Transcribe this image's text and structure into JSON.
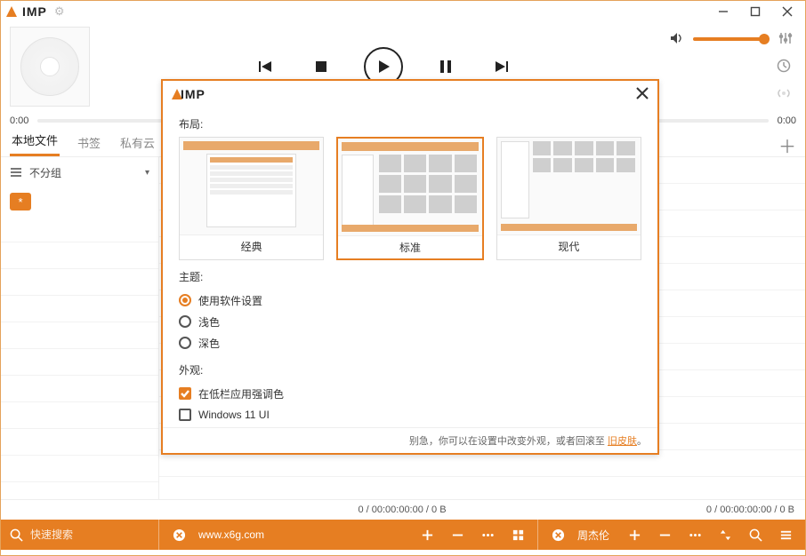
{
  "app": {
    "name": "IMP"
  },
  "window": {
    "minimize": "–",
    "maximize": "▢",
    "close": "×"
  },
  "player": {
    "time_current": "0:00",
    "time_total": "0:00"
  },
  "tabs": {
    "items": [
      {
        "label": "本地文件",
        "active": true
      },
      {
        "label": "书签",
        "active": false
      },
      {
        "label": "私有云",
        "active": false
      }
    ]
  },
  "sidebar": {
    "group_label": "不分组",
    "star": "*"
  },
  "info": {
    "left": "",
    "center": "0 / 00:00:00:00 / 0 B",
    "right": "0 / 00:00:00:00 / 0 B"
  },
  "bottombar": {
    "search_placeholder": "快速搜索",
    "panel1_label": "www.x6g.com",
    "panel2_label": "周杰伦"
  },
  "modal": {
    "layout_title": "布局:",
    "layouts": [
      {
        "label": "经典",
        "selected": false
      },
      {
        "label": "标准",
        "selected": true
      },
      {
        "label": "现代",
        "selected": false
      }
    ],
    "theme_title": "主题:",
    "themes": [
      {
        "label": "使用软件设置",
        "selected": true
      },
      {
        "label": "浅色",
        "selected": false
      },
      {
        "label": "深色",
        "selected": false
      }
    ],
    "appearance_title": "外观:",
    "appearance": [
      {
        "label": "在低栏应用强调色",
        "checked": true
      },
      {
        "label": "Windows 11 UI",
        "checked": false
      }
    ],
    "footer_text": "别急，你可以在设置中改变外观，或者回滚至 ",
    "footer_link": "旧皮肤",
    "footer_tail": "。"
  }
}
